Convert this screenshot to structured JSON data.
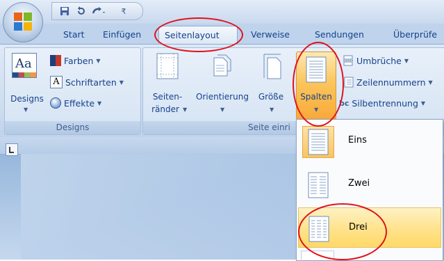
{
  "quick_access": {
    "customize_glyph": "₹"
  },
  "tabs": [
    "Start",
    "Einfügen",
    "Seitenlayout",
    "Verweise",
    "Sendungen",
    "Überprüfe"
  ],
  "active_tab": "Seitenlayout",
  "groups": {
    "designs": {
      "label": "Designs",
      "designs_button": "Designs",
      "items": [
        "Farben",
        "Schriftarten",
        "Effekte"
      ]
    },
    "page_setup": {
      "label": "Seite einri",
      "margins_line1": "Seiten-",
      "margins_line2": "ränder",
      "orientation": "Orientierung",
      "size": "Größe",
      "columns": "Spalten",
      "small_items": [
        "Umbrüche",
        "Zeilennummern",
        "Silbentrennung"
      ]
    }
  },
  "columns_dropdown": {
    "items": [
      {
        "label": "Eins",
        "icon": "one-column-icon"
      },
      {
        "label": "Zwei",
        "icon": "two-columns-icon"
      },
      {
        "label": "Drei",
        "icon": "three-columns-icon"
      }
    ],
    "selected": "Eins",
    "hovered": "Drei"
  },
  "annotations": {
    "color": "#e0121b"
  }
}
